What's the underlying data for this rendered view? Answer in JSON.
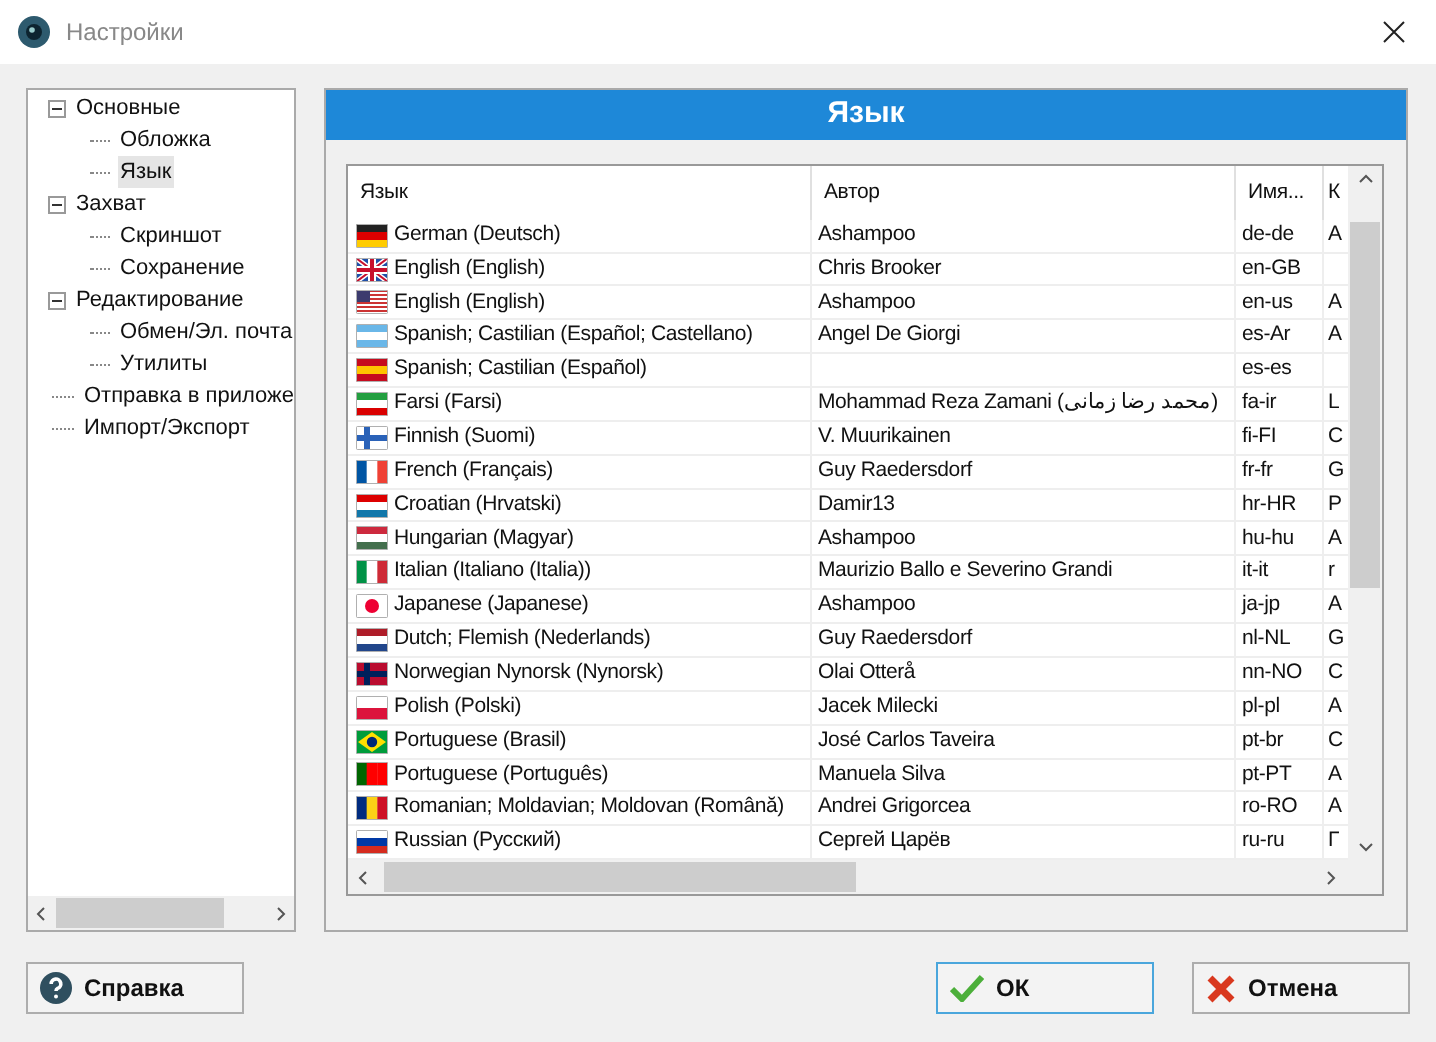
{
  "window": {
    "title": "Настройки"
  },
  "tree": [
    {
      "label": "Основные",
      "expanded": true,
      "selected": false,
      "children": [
        {
          "label": "Обложка",
          "selected": false
        },
        {
          "label": "Язык",
          "selected": true
        }
      ]
    },
    {
      "label": "Захват",
      "expanded": true,
      "selected": false,
      "children": [
        {
          "label": "Скриншот",
          "selected": false
        },
        {
          "label": "Сохранение",
          "selected": false
        }
      ]
    },
    {
      "label": "Редактирование",
      "expanded": true,
      "selected": false,
      "children": [
        {
          "label": "Обмен/Эл. почта",
          "selected": false
        },
        {
          "label": "Утилиты",
          "selected": false
        }
      ]
    },
    {
      "label": "Отправка в приложе",
      "selected": false
    },
    {
      "label": "Импорт/Экспорт",
      "selected": false
    }
  ],
  "panel": {
    "title": "Язык"
  },
  "table": {
    "columns": [
      "Язык",
      "Автор",
      "Имя...",
      "К"
    ],
    "rows": [
      [
        "German (Deutsch)",
        "Ashampoo",
        "de-de",
        "A"
      ],
      [
        "English (English)",
        "Chris Brooker",
        "en-GB",
        ""
      ],
      [
        "English (English)",
        "Ashampoo",
        "en-us",
        "A"
      ],
      [
        "Spanish; Castilian (Español; Castellano)",
        "Angel De Giorgi",
        "es-Ar",
        "A"
      ],
      [
        "Spanish; Castilian (Español)",
        "",
        "es-es",
        ""
      ],
      [
        "Farsi (Farsi)",
        "Mohammad Reza Zamani (محمد رضا زمانی)",
        "fa-ir",
        "L"
      ],
      [
        "Finnish (Suomi)",
        "V. Muurikainen",
        "fi-FI",
        "C"
      ],
      [
        "French (Français)",
        "Guy Raedersdorf",
        "fr-fr",
        "G"
      ],
      [
        "Croatian (Hrvatski)",
        "Damir13",
        "hr-HR",
        "P"
      ],
      [
        "Hungarian (Magyar)",
        "Ashampoo",
        "hu-hu",
        "A"
      ],
      [
        "Italian (Italiano (Italia))",
        "Maurizio Ballo e Severino Grandi",
        "it-it",
        "r"
      ],
      [
        "Japanese (Japanese)",
        "Ashampoo",
        "ja-jp",
        "A"
      ],
      [
        "Dutch; Flemish (Nederlands)",
        "Guy Raedersdorf",
        "nl-NL",
        "G"
      ],
      [
        "Norwegian Nynorsk (Nynorsk)",
        "Olai Otterå",
        "nn-NO",
        "C"
      ],
      [
        "Polish (Polski)",
        "Jacek Milecki",
        "pl-pl",
        "A"
      ],
      [
        "Portuguese (Brasil)",
        "José Carlos Taveira",
        "pt-br",
        "C"
      ],
      [
        "Portuguese (Português)",
        "Manuela Silva",
        "pt-PT",
        "A"
      ],
      [
        "Romanian; Moldavian; Moldovan (Română)",
        "Andrei Grigorcea",
        "ro-RO",
        "A"
      ],
      [
        "Russian (Русский)",
        "Сергей Царёв",
        "ru-ru",
        "Г"
      ]
    ]
  },
  "buttons": [
    {
      "kind": "help",
      "label": "Справка"
    },
    {
      "kind": "ok",
      "label": "ОК"
    },
    {
      "kind": "cancel",
      "label": "Отмена"
    }
  ]
}
